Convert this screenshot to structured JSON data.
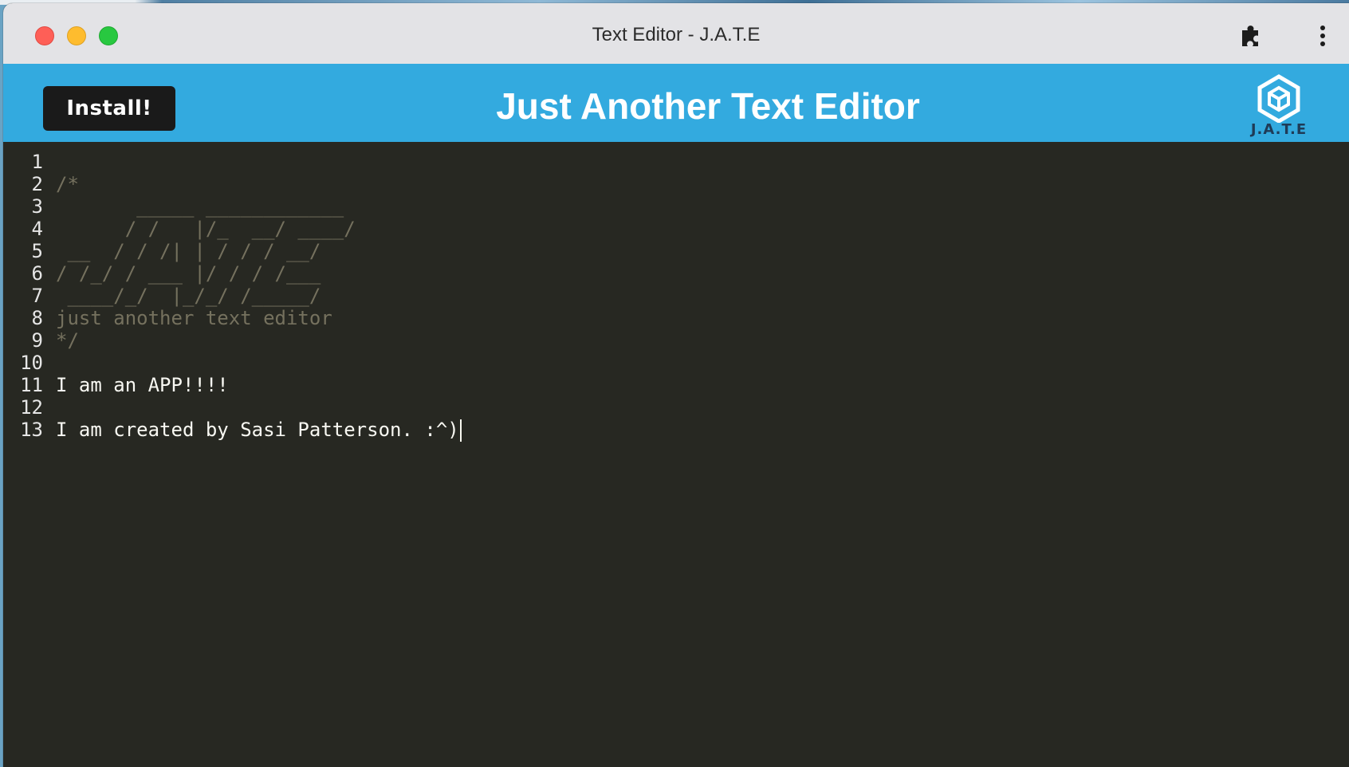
{
  "window": {
    "title": "Text Editor - J.A.T.E"
  },
  "header": {
    "install_label": "Install!",
    "app_title": "Just Another Text Editor",
    "logo_text": "J.A.T.E",
    "background_color": "#33aadf"
  },
  "editor": {
    "background_color": "#272822",
    "comment_color": "#75715e",
    "lines": [
      {
        "number": "1",
        "text": "",
        "type": "code"
      },
      {
        "number": "2",
        "text": "/*",
        "type": "comment"
      },
      {
        "number": "3",
        "text": "       _____ ____________",
        "type": "comment"
      },
      {
        "number": "4",
        "text": "      / /   |/_  __/ ____/",
        "type": "comment"
      },
      {
        "number": "5",
        "text": " __  / / /| | / / / __/",
        "type": "comment"
      },
      {
        "number": "6",
        "text": "/ /_/ / ___ |/ / / /___",
        "type": "comment"
      },
      {
        "number": "7",
        "text": " ____/_/  |_/_/ /_____/",
        "type": "comment"
      },
      {
        "number": "8",
        "text": "just another text editor",
        "type": "comment"
      },
      {
        "number": "9",
        "text": "*/",
        "type": "comment"
      },
      {
        "number": "10",
        "text": "",
        "type": "code"
      },
      {
        "number": "11",
        "text": "I am an APP!!!!",
        "type": "code"
      },
      {
        "number": "12",
        "text": "",
        "type": "code"
      },
      {
        "number": "13",
        "text": "I am created by Sasi Patterson. :^)",
        "type": "code"
      }
    ]
  }
}
